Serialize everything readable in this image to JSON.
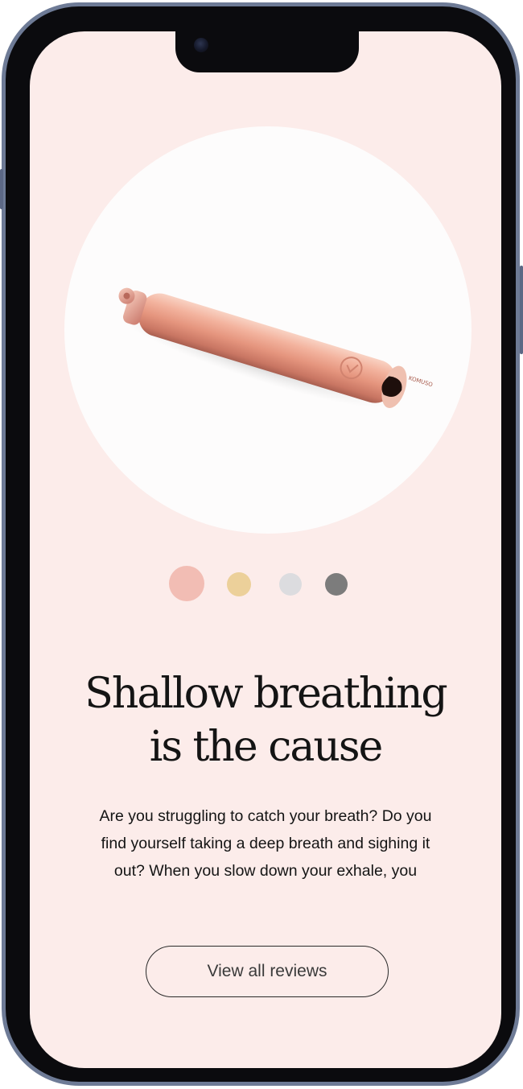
{
  "product": {
    "image_icon": "breathing-necklace-product-icon",
    "engraving": "KOMUSO"
  },
  "swatches": [
    {
      "name": "rose-gold",
      "color": "#f2bdb4",
      "selected": true
    },
    {
      "name": "gold",
      "color": "#ecd09a",
      "selected": false
    },
    {
      "name": "silver",
      "color": "#dcdcdf",
      "selected": false
    },
    {
      "name": "gunmetal",
      "color": "#7c7c7c",
      "selected": false
    }
  ],
  "headline": {
    "line1": "Shallow breathing",
    "line2": "is the cause"
  },
  "body": {
    "text": "Are you struggling to catch your breath? Do you find yourself taking a deep breath and sighing it out? When you slow down your exhale, you"
  },
  "cta": {
    "label": "View all reviews"
  },
  "colors": {
    "screen_background": "#fcecea",
    "circle_background": "#fdfcfc",
    "text": "#141414",
    "frame": "#6e7b96"
  }
}
